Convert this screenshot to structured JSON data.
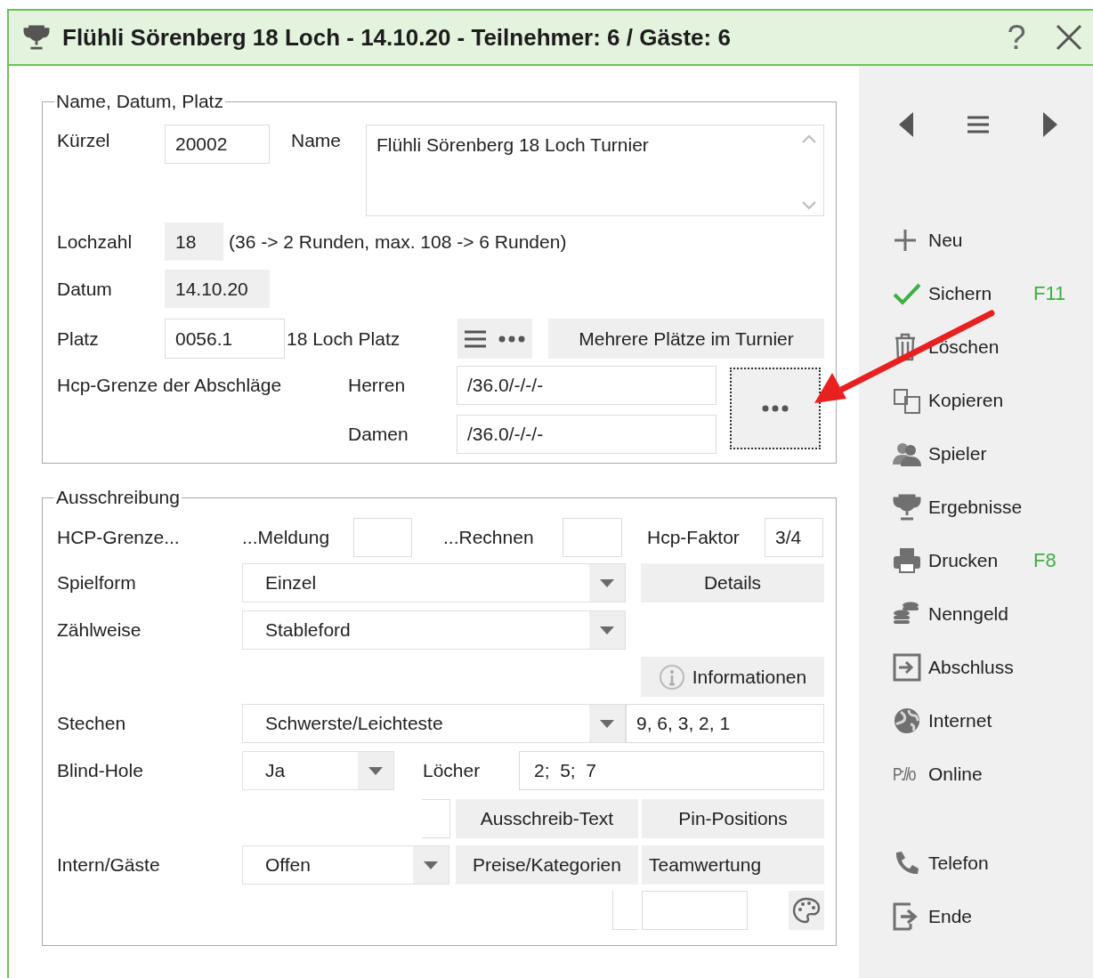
{
  "window": {
    "title": "Flühli Sörenberg 18 Loch - 14.10.20 - Teilnehmer: 6 / Gäste: 6",
    "help": "?"
  },
  "name_section": {
    "legend": "Name, Datum, Platz",
    "kuerzel": {
      "label": "Kürzel",
      "value": "20002"
    },
    "name": {
      "label": "Name",
      "value": "Flühli Sörenberg 18 Loch Turnier"
    },
    "lochzahl": {
      "label": "Lochzahl",
      "value": "18",
      "note": "(36 -> 2 Runden, max. 108 -> 6 Runden)"
    },
    "datum": {
      "label": "Datum",
      "value": "14.10.20"
    },
    "platz": {
      "label": "Platz",
      "value": "0056.1",
      "course": "18 Loch Platz",
      "button": "Mehrere Plätze im Turnier"
    },
    "hcp_limit": {
      "label": "Hcp-Grenze der Abschläge",
      "men": {
        "label": "Herren",
        "value": "/36.0/-/-/-"
      },
      "women": {
        "label": "Damen",
        "value": "/36.0/-/-/-"
      }
    }
  },
  "tender_section": {
    "legend": "Ausschreibung",
    "hcp_limit_label": "HCP-Grenze...",
    "registration": {
      "label": "...Meldung"
    },
    "calculation": {
      "label": "...Rechnen"
    },
    "hcp_factor": {
      "label": "Hcp-Faktor",
      "value": "3/4"
    },
    "game_form": {
      "label": "Spielform",
      "value": "Einzel",
      "button": "Details"
    },
    "scoring": {
      "label": "Zählweise",
      "value": "Stableford"
    },
    "info_button": "Informationen",
    "playoff": {
      "label": "Stechen",
      "value": "Schwerste/Leichteste",
      "holes": "9, 6, 3, 2, 1"
    },
    "blind_hole": {
      "label": "Blind-Hole",
      "value": "Ja",
      "holes_label": "Löcher",
      "holes": "2;  5;  7"
    },
    "text_button": "Ausschreib-Text",
    "pin_button": "Pin-Positions",
    "internal_guests": {
      "label": "Intern/Gäste",
      "value": "Offen"
    },
    "prizes_button": "Preise/Kategorien",
    "team_button": "Teamwertung"
  },
  "sidebar": {
    "groups": [
      [
        {
          "kind": "plus",
          "label": "Neu"
        },
        {
          "kind": "check",
          "label": "Sichern",
          "shortcut": "F11"
        },
        {
          "kind": "trash",
          "label": "Löschen"
        },
        {
          "kind": "copy",
          "label": "Kopieren"
        }
      ],
      [
        {
          "kind": "players",
          "label": "Spieler"
        },
        {
          "kind": "trophy",
          "label": "Ergebnisse"
        },
        {
          "kind": "printer",
          "label": "Drucken",
          "shortcut": "F8"
        },
        {
          "kind": "coins",
          "label": "Nenngeld"
        },
        {
          "kind": "exit-box",
          "label": "Abschluss"
        }
      ],
      [
        {
          "kind": "globe",
          "label": "Internet"
        },
        {
          "kind": "logo",
          "label": "Online",
          "logo_text": "P://o"
        }
      ],
      [
        {
          "kind": "phone",
          "label": "Telefon"
        },
        {
          "kind": "exit",
          "label": "Ende"
        }
      ]
    ]
  }
}
